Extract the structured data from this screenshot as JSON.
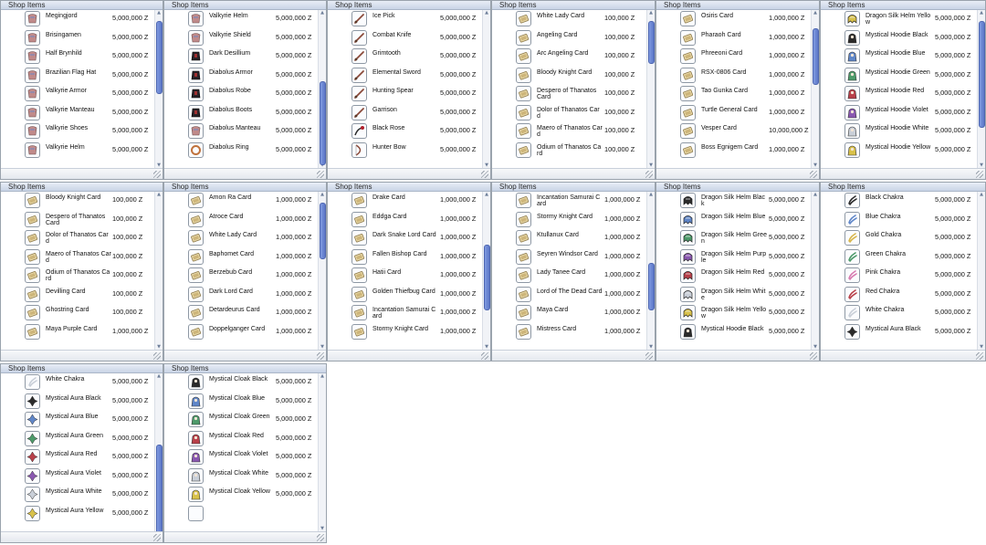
{
  "title": "Shop Items",
  "colors": {
    "window_border": "#9aa3ad",
    "title_bar": "#c9d4e6",
    "scroll_thumb": "#5c77c8"
  },
  "windows": [
    {
      "id": "w1",
      "items": [
        {
          "name": "Megingjord",
          "price": "5,000,000 Z",
          "icon": "belt-icon"
        },
        {
          "name": "Brisingamen",
          "price": "5,000,000 Z",
          "icon": "necklace-icon"
        },
        {
          "name": "Half Brynhild",
          "price": "5,000,000 Z",
          "icon": "armor-icon"
        },
        {
          "name": "Brazilian Flag Hat",
          "price": "5,000,000 Z",
          "icon": "hat-icon"
        },
        {
          "name": "Valkyrie Armor",
          "price": "5,000,000 Z",
          "icon": "armor-icon"
        },
        {
          "name": "Valkyrie Manteau",
          "price": "5,000,000 Z",
          "icon": "manteau-icon"
        },
        {
          "name": "Valkyrie Shoes",
          "price": "5,000,000 Z",
          "icon": "shoes-icon"
        },
        {
          "name": "Valkyrie Helm",
          "price": "5,000,000 Z",
          "icon": "helm-icon"
        }
      ]
    },
    {
      "id": "w2",
      "items": [
        {
          "name": "Valkyrie Helm",
          "price": "5,000,000 Z",
          "icon": "helm-icon"
        },
        {
          "name": "Valkyrie Shield",
          "price": "5,000,000 Z",
          "icon": "shield-icon"
        },
        {
          "name": "Dark Desillium",
          "price": "5,000,000 Z",
          "icon": "dark-armor-icon"
        },
        {
          "name": "Diabolus Armor",
          "price": "5,000,000 Z",
          "icon": "dark-armor-icon"
        },
        {
          "name": "Diabolus Robe",
          "price": "5,000,000 Z",
          "icon": "robe-icon"
        },
        {
          "name": "Diabolus Boots",
          "price": "5,000,000 Z",
          "icon": "boots-icon"
        },
        {
          "name": "Diabolus Manteau",
          "price": "5,000,000 Z",
          "icon": "manteau-icon"
        },
        {
          "name": "Diabolus Ring",
          "price": "5,000,000 Z",
          "icon": "ring-icon"
        }
      ]
    },
    {
      "id": "w3",
      "items": [
        {
          "name": "Ice Pick",
          "price": "5,000,000 Z",
          "icon": "dagger-icon"
        },
        {
          "name": "Combat Knife",
          "price": "5,000,000 Z",
          "icon": "dagger-icon"
        },
        {
          "name": "Grimtooth",
          "price": "5,000,000 Z",
          "icon": "dagger-icon"
        },
        {
          "name": "Elemental Sword",
          "price": "5,000,000 Z",
          "icon": "sword-icon"
        },
        {
          "name": "Hunting Spear",
          "price": "5,000,000 Z",
          "icon": "spear-icon"
        },
        {
          "name": "Garrison",
          "price": "5,000,000 Z",
          "icon": "staff-icon"
        },
        {
          "name": "Black Rose",
          "price": "5,000,000 Z",
          "icon": "whip-icon"
        },
        {
          "name": "Hunter Bow",
          "price": "5,000,000 Z",
          "icon": "bow-icon"
        }
      ]
    },
    {
      "id": "w4",
      "items": [
        {
          "name": "White Lady Card",
          "price": "100,000 Z",
          "icon": "card-icon"
        },
        {
          "name": "Angeling Card",
          "price": "100,000 Z",
          "icon": "card-icon"
        },
        {
          "name": "Arc Angeling Card",
          "price": "100,000 Z",
          "icon": "card-icon"
        },
        {
          "name": "Bloody Knight Card",
          "price": "100,000 Z",
          "icon": "card-icon"
        },
        {
          "name": "Despero of Thanatos Card",
          "price": "100,000 Z",
          "icon": "card-icon"
        },
        {
          "name": "Dolor of Thanatos Card",
          "price": "100,000 Z",
          "icon": "card-icon"
        },
        {
          "name": "Maero of Thanatos Card",
          "price": "100,000 Z",
          "icon": "card-icon"
        },
        {
          "name": "Odium of Thanatos Card",
          "price": "100,000 Z",
          "icon": "card-icon"
        }
      ]
    },
    {
      "id": "w5",
      "items": [
        {
          "name": "Osiris Card",
          "price": "1,000,000 Z",
          "icon": "card-icon"
        },
        {
          "name": "Pharaoh Card",
          "price": "1,000,000 Z",
          "icon": "card-icon"
        },
        {
          "name": "Phreeoni Card",
          "price": "1,000,000 Z",
          "icon": "card-icon"
        },
        {
          "name": "RSX-0806 Card",
          "price": "1,000,000 Z",
          "icon": "card-icon"
        },
        {
          "name": "Tao Gunka Card",
          "price": "1,000,000 Z",
          "icon": "card-icon"
        },
        {
          "name": "Turtle General Card",
          "price": "1,000,000 Z",
          "icon": "card-icon"
        },
        {
          "name": "Vesper Card",
          "price": "10,000,000 Z",
          "icon": "card-icon"
        },
        {
          "name": "Boss Egnigem Card",
          "price": "1,000,000 Z",
          "icon": "card-icon"
        }
      ]
    },
    {
      "id": "w6",
      "items": [
        {
          "name": "Dragon Silk Helm Yellow",
          "price": "5,000,000 Z",
          "icon": "dragon-helm-yellow-icon"
        },
        {
          "name": "Mystical Hoodie Black",
          "price": "5,000,000 Z",
          "icon": "hoodie-black-icon"
        },
        {
          "name": "Mystical Hoodie Blue",
          "price": "5,000,000 Z",
          "icon": "hoodie-blue-icon"
        },
        {
          "name": "Mystical Hoodie Green",
          "price": "5,000,000 Z",
          "icon": "hoodie-green-icon"
        },
        {
          "name": "Mystical Hoodie Red",
          "price": "5,000,000 Z",
          "icon": "hoodie-red-icon"
        },
        {
          "name": "Mystical Hoodie Violet",
          "price": "5,000,000 Z",
          "icon": "hoodie-violet-icon"
        },
        {
          "name": "Mystical Hoodie White",
          "price": "5,000,000 Z",
          "icon": "hoodie-white-icon"
        },
        {
          "name": "Mystical Hoodie Yellow",
          "price": "5,000,000 Z",
          "icon": "hoodie-yellow-icon"
        }
      ]
    },
    {
      "id": "w7",
      "items": [
        {
          "name": "Bloody Knight Card",
          "price": "100,000 Z",
          "icon": "card-icon"
        },
        {
          "name": "Despero of Thanatos Card",
          "price": "100,000 Z",
          "icon": "card-icon"
        },
        {
          "name": "Dolor of Thanatos Card",
          "price": "100,000 Z",
          "icon": "card-icon"
        },
        {
          "name": "Maero of Thanatos Card",
          "price": "100,000 Z",
          "icon": "card-icon"
        },
        {
          "name": "Odium of Thanatos Card",
          "price": "100,000 Z",
          "icon": "card-icon"
        },
        {
          "name": "Devilling Card",
          "price": "100,000 Z",
          "icon": "card-icon"
        },
        {
          "name": "Ghostring Card",
          "price": "100,000 Z",
          "icon": "card-icon"
        },
        {
          "name": "Maya Purple Card",
          "price": "1,000,000 Z",
          "icon": "card-icon"
        }
      ]
    },
    {
      "id": "w8",
      "items": [
        {
          "name": "Amon Ra Card",
          "price": "1,000,000 Z",
          "icon": "card-icon"
        },
        {
          "name": "Atroce Card",
          "price": "1,000,000 Z",
          "icon": "card-icon"
        },
        {
          "name": "White Lady Card",
          "price": "1,000,000 Z",
          "icon": "card-icon"
        },
        {
          "name": "Baphomet Card",
          "price": "1,000,000 Z",
          "icon": "card-icon"
        },
        {
          "name": "Berzebub Card",
          "price": "1,000,000 Z",
          "icon": "card-icon"
        },
        {
          "name": "Dark Lord Card",
          "price": "1,000,000 Z",
          "icon": "card-icon"
        },
        {
          "name": "Detardeurus Card",
          "price": "1,000,000 Z",
          "icon": "card-icon"
        },
        {
          "name": "Doppelganger Card",
          "price": "1,000,000 Z",
          "icon": "card-icon"
        }
      ]
    },
    {
      "id": "w9",
      "items": [
        {
          "name": "Drake Card",
          "price": "1,000,000 Z",
          "icon": "card-icon"
        },
        {
          "name": "Eddga Card",
          "price": "1,000,000 Z",
          "icon": "card-icon"
        },
        {
          "name": "Dark Snake Lord Card",
          "price": "1,000,000 Z",
          "icon": "card-icon"
        },
        {
          "name": "Fallen Bishop Card",
          "price": "1,000,000 Z",
          "icon": "card-icon"
        },
        {
          "name": "Hatii Card",
          "price": "1,000,000 Z",
          "icon": "card-icon"
        },
        {
          "name": "Golden Thiefbug Card",
          "price": "1,000,000 Z",
          "icon": "card-icon"
        },
        {
          "name": "Incantation Samurai Card",
          "price": "1,000,000 Z",
          "icon": "card-icon"
        },
        {
          "name": "Stormy Knight Card",
          "price": "1,000,000 Z",
          "icon": "card-icon"
        }
      ]
    },
    {
      "id": "w10",
      "items": [
        {
          "name": "Incantation Samurai Card",
          "price": "1,000,000 Z",
          "icon": "card-icon"
        },
        {
          "name": "Stormy Knight Card",
          "price": "1,000,000 Z",
          "icon": "card-icon"
        },
        {
          "name": "Ktullanux Card",
          "price": "1,000,000 Z",
          "icon": "card-icon"
        },
        {
          "name": "Seyren Windsor Card",
          "price": "1,000,000 Z",
          "icon": "card-icon"
        },
        {
          "name": "Lady Tanee Card",
          "price": "1,000,000 Z",
          "icon": "card-icon"
        },
        {
          "name": "Lord of The Dead Card",
          "price": "1,000,000 Z",
          "icon": "card-icon"
        },
        {
          "name": "Maya Card",
          "price": "1,000,000 Z",
          "icon": "card-icon"
        },
        {
          "name": "Mistress Card",
          "price": "1,000,000 Z",
          "icon": "card-icon"
        }
      ]
    },
    {
      "id": "w11",
      "items": [
        {
          "name": "Dragon Silk Helm Black",
          "price": "5,000,000 Z",
          "icon": "dragon-helm-black-icon"
        },
        {
          "name": "Dragon Silk Helm Blue",
          "price": "5,000,000 Z",
          "icon": "dragon-helm-blue-icon"
        },
        {
          "name": "Dragon Silk Helm Green",
          "price": "5,000,000 Z",
          "icon": "dragon-helm-green-icon"
        },
        {
          "name": "Dragon Silk Helm Purple",
          "price": "5,000,000 Z",
          "icon": "dragon-helm-purple-icon"
        },
        {
          "name": "Dragon Silk Helm Red",
          "price": "5,000,000 Z",
          "icon": "dragon-helm-red-icon"
        },
        {
          "name": "Dragon Silk Helm White",
          "price": "5,000,000 Z",
          "icon": "dragon-helm-white-icon"
        },
        {
          "name": "Dragon Silk Helm Yellow",
          "price": "5,000,000 Z",
          "icon": "dragon-helm-yellow-icon"
        },
        {
          "name": "Mystical Hoodie Black",
          "price": "5,000,000 Z",
          "icon": "hoodie-black-icon"
        }
      ]
    },
    {
      "id": "w12",
      "items": [
        {
          "name": "Black Chakra",
          "price": "5,000,000 Z",
          "icon": "chakra-black-icon"
        },
        {
          "name": "Blue Chakra",
          "price": "5,000,000 Z",
          "icon": "chakra-blue-icon"
        },
        {
          "name": "Gold Chakra",
          "price": "5,000,000 Z",
          "icon": "chakra-gold-icon"
        },
        {
          "name": "Green Chakra",
          "price": "5,000,000 Z",
          "icon": "chakra-green-icon"
        },
        {
          "name": "Pink Chakra",
          "price": "5,000,000 Z",
          "icon": "chakra-pink-icon"
        },
        {
          "name": "Red Chakra",
          "price": "5,000,000 Z",
          "icon": "chakra-red-icon"
        },
        {
          "name": "White Chakra",
          "price": "5,000,000 Z",
          "icon": "chakra-white-icon"
        },
        {
          "name": "Mystical Aura Black",
          "price": "5,000,000 Z",
          "icon": "aura-black-icon"
        }
      ]
    },
    {
      "id": "w13",
      "items": [
        {
          "name": "White Chakra",
          "price": "5,000,000 Z",
          "icon": "chakra-white-icon"
        },
        {
          "name": "Mystical Aura Black",
          "price": "5,000,000 Z",
          "icon": "aura-black-icon"
        },
        {
          "name": "Mystical Aura Blue",
          "price": "5,000,000 Z",
          "icon": "aura-blue-icon"
        },
        {
          "name": "Mystical Aura Green",
          "price": "5,000,000 Z",
          "icon": "aura-green-icon"
        },
        {
          "name": "Mystical Aura Red",
          "price": "5,000,000 Z",
          "icon": "aura-red-icon"
        },
        {
          "name": "Mystical Aura Violet",
          "price": "5,000,000 Z",
          "icon": "aura-violet-icon"
        },
        {
          "name": "Mystical Aura White",
          "price": "5,000,000 Z",
          "icon": "aura-white-icon"
        },
        {
          "name": "Mystical Aura Yellow",
          "price": "5,000,000 Z",
          "icon": "aura-yellow-icon"
        }
      ]
    },
    {
      "id": "w14",
      "items": [
        {
          "name": "Mystical Cloak Black",
          "price": "5,000,000 Z",
          "icon": "cloak-black-icon"
        },
        {
          "name": "Mystical Cloak Blue",
          "price": "5,000,000 Z",
          "icon": "cloak-blue-icon"
        },
        {
          "name": "Mystical Cloak Green",
          "price": "5,000,000 Z",
          "icon": "cloak-green-icon"
        },
        {
          "name": "Mystical Cloak Red",
          "price": "5,000,000 Z",
          "icon": "cloak-red-icon"
        },
        {
          "name": "Mystical Cloak Violet",
          "price": "5,000,000 Z",
          "icon": "cloak-violet-icon"
        },
        {
          "name": "Mystical Cloak White",
          "price": "5,000,000 Z",
          "icon": "cloak-white-icon"
        },
        {
          "name": "Mystical Cloak Yellow",
          "price": "5,000,000 Z",
          "icon": "cloak-yellow-icon"
        },
        {
          "name": "",
          "price": "",
          "icon": "empty-slot-icon"
        }
      ]
    }
  ]
}
